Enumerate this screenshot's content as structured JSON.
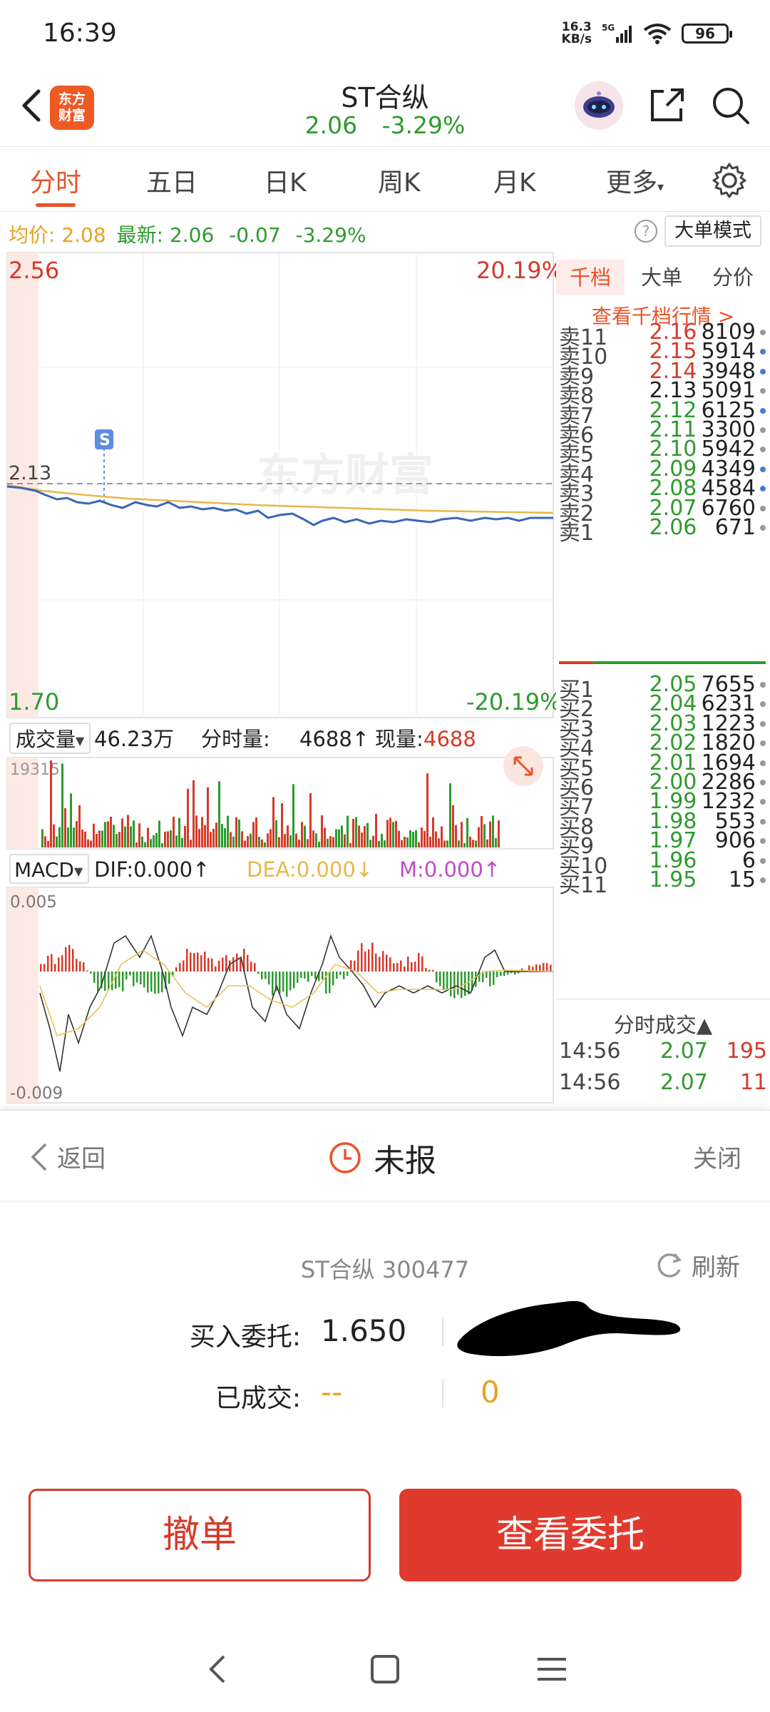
{
  "status": {
    "time": "16:39",
    "net_speed_top": "16.3",
    "net_speed_bottom": "KB/s",
    "network": "5G",
    "battery": "96"
  },
  "header": {
    "logo_line1": "东方",
    "logo_line2": "财富",
    "title": "ST合纵",
    "price": "2.06",
    "change_pct": "-3.29%"
  },
  "tabs": [
    {
      "label": "分时"
    },
    {
      "label": "五日"
    },
    {
      "label": "日K"
    },
    {
      "label": "周K"
    },
    {
      "label": "月K"
    },
    {
      "label": "更多"
    }
  ],
  "price_info": {
    "avg_label": "均价:",
    "avg_value": "2.08",
    "latest_label": "最新:",
    "latest_value": "2.06",
    "change": "-0.07",
    "change_pct": "-3.29%",
    "help": "?",
    "big_order_mode": "大单模式"
  },
  "main_chart": {
    "price_top": "2.56",
    "pct_top": "20.19%",
    "price_bottom": "1.70",
    "pct_bottom": "-20.19%",
    "ref_price": "2.13",
    "marker": "S",
    "watermark": "东方财富"
  },
  "volume_bar": {
    "selector": "成交量",
    "total": "46.23万",
    "minute_label": "分时量:",
    "minute_value": "4688↑",
    "current_label": "现量:",
    "current_value": "4688",
    "max_label": "19315"
  },
  "macd_bar": {
    "selector": "MACD",
    "dif": "DIF:0.000↑",
    "dea": "DEA:0.000↓",
    "m": "M:0.000↑",
    "top_label": "0.005",
    "bottom_label": "-0.009"
  },
  "side_panel": {
    "tabs": [
      {
        "label": "千档"
      },
      {
        "label": "大单"
      },
      {
        "label": "分价"
      }
    ],
    "link": "查看千档行情 >",
    "sells": [
      {
        "label": "卖11",
        "price": "2.16",
        "volume": "8109",
        "color": "red",
        "dot": "gray"
      },
      {
        "label": "卖10",
        "price": "2.15",
        "volume": "5914",
        "color": "red",
        "dot": "blue"
      },
      {
        "label": "卖9",
        "price": "2.14",
        "volume": "3948",
        "color": "red",
        "dot": "blue"
      },
      {
        "label": "卖8",
        "price": "2.13",
        "volume": "5091",
        "color": "black",
        "dot": "gray"
      },
      {
        "label": "卖7",
        "price": "2.12",
        "volume": "6125",
        "color": "green",
        "dot": "blue"
      },
      {
        "label": "卖6",
        "price": "2.11",
        "volume": "3300",
        "color": "green",
        "dot": "gray"
      },
      {
        "label": "卖5",
        "price": "2.10",
        "volume": "5942",
        "color": "green",
        "dot": "gray"
      },
      {
        "label": "卖4",
        "price": "2.09",
        "volume": "4349",
        "color": "green",
        "dot": "blue"
      },
      {
        "label": "卖3",
        "price": "2.08",
        "volume": "4584",
        "color": "green",
        "dot": "blue"
      },
      {
        "label": "卖2",
        "price": "2.07",
        "volume": "6760",
        "color": "green",
        "dot": "gray"
      },
      {
        "label": "卖1",
        "price": "2.06",
        "volume": "671",
        "color": "green",
        "dot": "gray"
      }
    ],
    "buys": [
      {
        "label": "买1",
        "price": "2.05",
        "volume": "7655",
        "color": "green",
        "dot": "gray"
      },
      {
        "label": "买2",
        "price": "2.04",
        "volume": "6231",
        "color": "green",
        "dot": "gray"
      },
      {
        "label": "买3",
        "price": "2.03",
        "volume": "1223",
        "color": "green",
        "dot": "gray"
      },
      {
        "label": "买4",
        "price": "2.02",
        "volume": "1820",
        "color": "green",
        "dot": "gray"
      },
      {
        "label": "买5",
        "price": "2.01",
        "volume": "1694",
        "color": "green",
        "dot": "gray"
      },
      {
        "label": "买6",
        "price": "2.00",
        "volume": "2286",
        "color": "green",
        "dot": "gray"
      },
      {
        "label": "买7",
        "price": "1.99",
        "volume": "1232",
        "color": "green",
        "dot": "gray"
      },
      {
        "label": "买8",
        "price": "1.98",
        "volume": "553",
        "color": "green",
        "dot": "gray"
      },
      {
        "label": "买9",
        "price": "1.97",
        "volume": "906",
        "color": "green",
        "dot": "gray"
      },
      {
        "label": "买10",
        "price": "1.96",
        "volume": "6",
        "color": "green",
        "dot": "gray"
      },
      {
        "label": "买11",
        "price": "1.95",
        "volume": "15",
        "color": "green",
        "dot": "gray"
      }
    ],
    "trades_title": "分时成交▲",
    "trades": [
      {
        "time": "14:56",
        "price": "2.07",
        "volume": "195"
      },
      {
        "time": "14:56",
        "price": "2.07",
        "volume": "11"
      }
    ]
  },
  "order_panel": {
    "back_label": "返回",
    "status": "未报",
    "close_label": "关闭",
    "stock": "ST合纵 300477",
    "refresh": "刷新",
    "buy_label": "买入委托:",
    "buy_price": "1.650",
    "filled_label": "已成交:",
    "filled_value": "--",
    "filled_qty": "0",
    "cancel_btn": "撤单",
    "view_btn": "查看委托"
  },
  "colors": {
    "accent": "#e8542a",
    "up": "#d63a2a",
    "down": "#2e9a2e",
    "price_line": "#3a66b8",
    "avg_line": "#e6b84a"
  }
}
